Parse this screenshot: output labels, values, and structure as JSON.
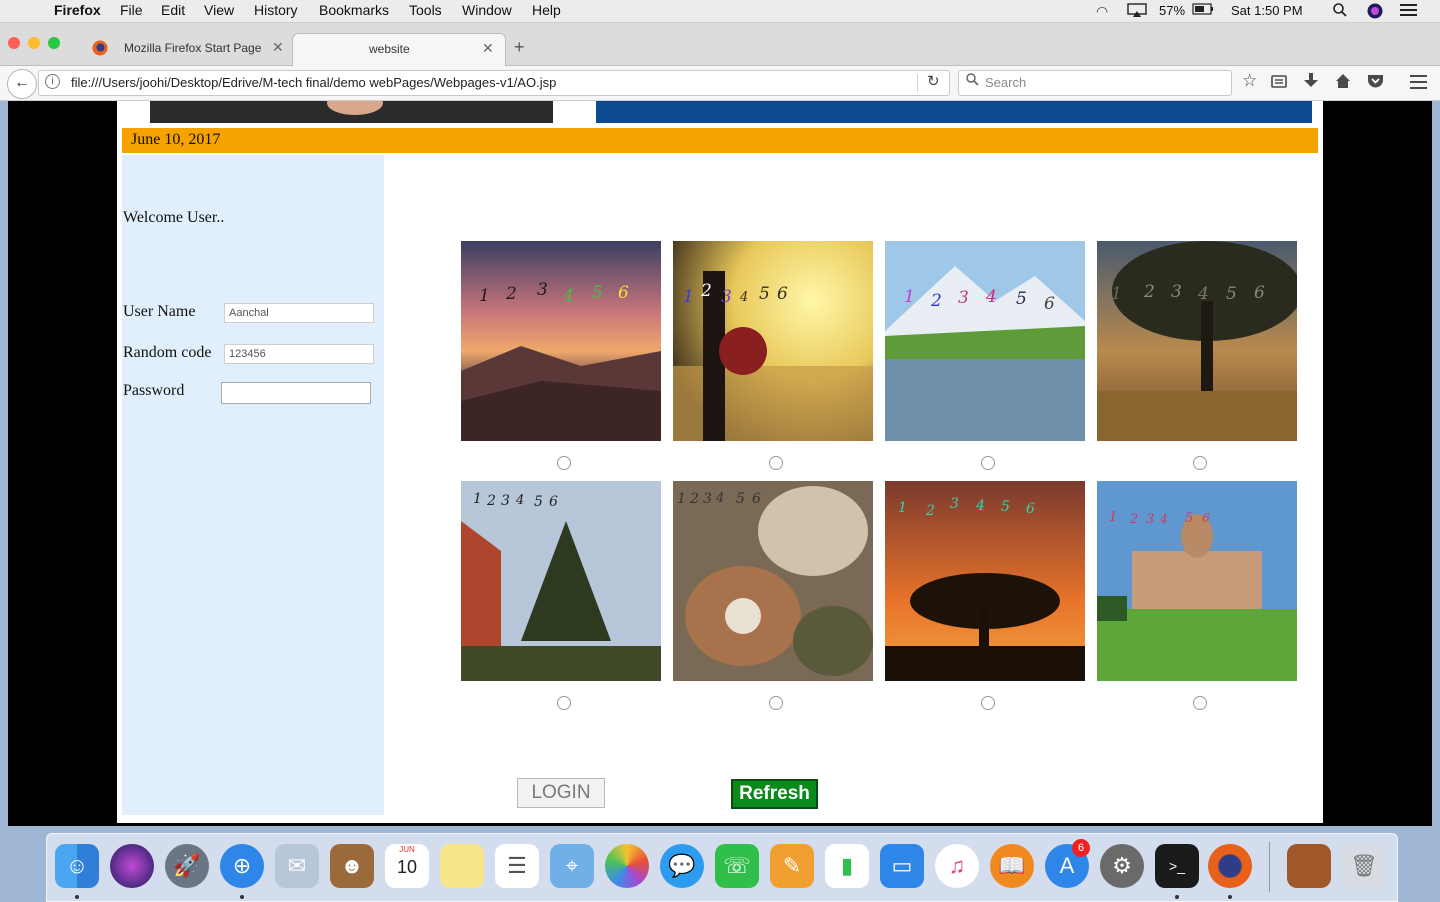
{
  "menubar": {
    "app": "Firefox",
    "items": [
      "File",
      "Edit",
      "View",
      "History",
      "Bookmarks",
      "Tools",
      "Window",
      "Help"
    ],
    "battery": "57%",
    "clock": "Sat 1:50 PM"
  },
  "tabs": [
    {
      "label": "Mozilla Firefox Start Page",
      "active": false
    },
    {
      "label": "website",
      "active": true
    }
  ],
  "navbar": {
    "url": "file:///Users/joohi/Desktop/Edrive/M-tech final/demo webPages/Webpages-v1/AO.jsp",
    "search_placeholder": "Search"
  },
  "page": {
    "date": "June 10, 2017",
    "welcome": "Welcome User..",
    "username_label": "User Name",
    "username_value": "Aanchal",
    "random_label": "Random code",
    "random_value": "123456",
    "password_label": "Password",
    "password_value": "",
    "login_label": "LOGIN",
    "refresh_label": "Refresh",
    "image_digits": [
      "1",
      "2",
      "3",
      "4",
      "5",
      "6"
    ]
  },
  "dock": {
    "calendar_month": "JUN",
    "calendar_day": "10",
    "appstore_badge": "6"
  },
  "colors": {
    "date_bar": "#f6a300",
    "sidebar_bg": "#e1eefc",
    "refresh_bg": "#098a1a",
    "banner_right": "#0d4a92"
  }
}
